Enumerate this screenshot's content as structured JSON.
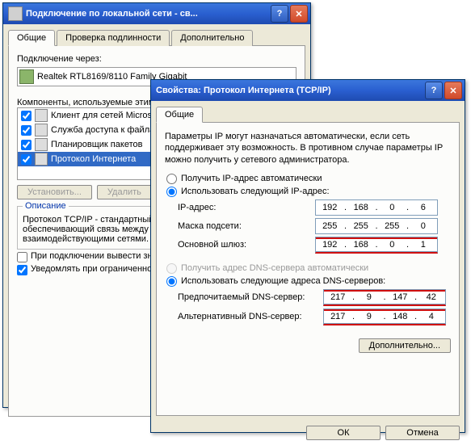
{
  "win1": {
    "title": "Подключение по локальной сети - св...",
    "tabs": [
      "Общие",
      "Проверка подлинности",
      "Дополнительно"
    ],
    "connect_via": "Подключение через:",
    "adapter": "Realtek RTL8169/8110 Family Gigabit",
    "components_label": "Компоненты, используемые этим",
    "components": [
      "Клиент для сетей Microsoft",
      "Служба доступа к файлам",
      "Планировщик пакетов",
      "Протокол Интернета"
    ],
    "btn_install": "Установить...",
    "btn_uninstall": "Удалить",
    "desc_legend": "Описание",
    "desc_text": "Протокол TCP/IP - стандартный протокол глобальных сетей, обеспечивающий связь между различными взаимодействующими сетями.",
    "chk_notify": "При подключении вывести значок в",
    "chk_warn": "Уведомлять при ограниченном подключении"
  },
  "win2": {
    "title": "Свойства: Протокол Интернета (TCP/IP)",
    "tab": "Общие",
    "intro": "Параметры IP могут назначаться автоматически, если сеть поддерживает эту возможность. В противном случае параметры IP можно получить у сетевого администратора.",
    "r_auto_ip": "Получить IP-адрес автоматически",
    "r_manual_ip": "Использовать следующий IP-адрес:",
    "l_ip": "IP-адрес:",
    "l_mask": "Маска подсети:",
    "l_gw": "Основной шлюз:",
    "ip": [
      "192",
      "168",
      "0",
      "6"
    ],
    "mask": [
      "255",
      "255",
      "255",
      "0"
    ],
    "gw": [
      "192",
      "168",
      "0",
      "1"
    ],
    "r_auto_dns": "Получить адрес DNS-сервера автоматически",
    "r_manual_dns": "Использовать следующие адреса DNS-серверов:",
    "l_dns1": "Предпочитаемый DNS-сервер:",
    "l_dns2": "Альтернативный DNS-сервер:",
    "dns1": [
      "217",
      "9",
      "147",
      "42"
    ],
    "dns2": [
      "217",
      "9",
      "148",
      "4"
    ],
    "btn_adv": "Дополнительно...",
    "btn_ok": "ОК",
    "btn_cancel": "Отмена"
  }
}
